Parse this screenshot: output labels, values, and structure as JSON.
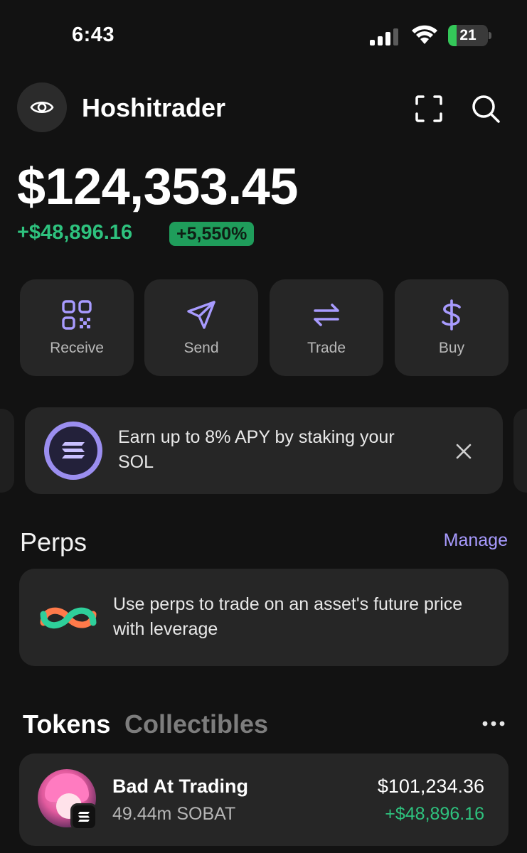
{
  "status_bar": {
    "time": "6:43",
    "battery_level": "21",
    "battery_fraction": 0.21,
    "signal_icon": "cellular-signal-icon",
    "wifi_icon": "wifi-icon",
    "battery_icon": "battery-charging-icon"
  },
  "header": {
    "account_name": "Hoshitrader",
    "eye_icon": "eye-icon",
    "scan_icon": "scan-icon",
    "search_icon": "search-icon"
  },
  "balance": {
    "total": "$124,353.45",
    "change": "+$48,896.16",
    "change_percent": "+5,550%"
  },
  "actions": [
    {
      "label": "Receive",
      "icon": "qr-code-icon"
    },
    {
      "label": "Send",
      "icon": "send-icon"
    },
    {
      "label": "Trade",
      "icon": "swap-icon"
    },
    {
      "label": "Buy",
      "icon": "dollar-icon"
    }
  ],
  "promo": {
    "text": "Earn up to 8% APY by staking your SOL",
    "icon": "solana-icon",
    "close_icon": "close-icon"
  },
  "perps": {
    "title": "Perps",
    "manage_label": "Manage",
    "description": "Use perps to trade on an asset's future price with leverage",
    "icon": "perps-logo-icon"
  },
  "tabs": {
    "tokens": "Tokens",
    "collectibles": "Collectibles",
    "more_icon": "more-icon"
  },
  "tokens": [
    {
      "name": "Bad At Trading",
      "amount": "49.44m SOBAT",
      "value": "$101,234.36",
      "change": "+$48,896.16"
    }
  ],
  "colors": {
    "background": "#121212",
    "card": "#262626",
    "positive": "#2ec27e",
    "accent": "#a89bff"
  }
}
